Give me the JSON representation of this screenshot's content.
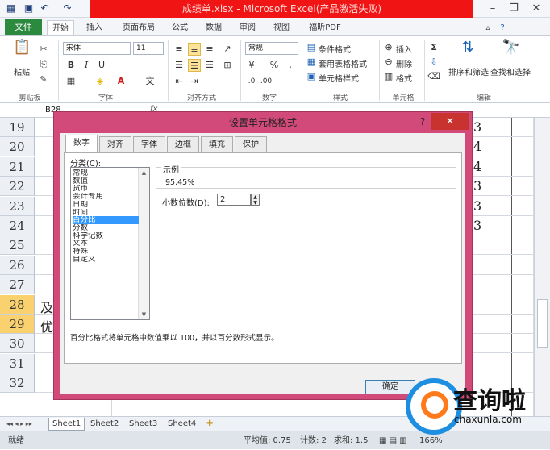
{
  "titlebar": {
    "title": "成绩单.xlsx - Microsoft Excel(产品激活失败)",
    "minimize": "–",
    "restore": "❐",
    "close": "✕"
  },
  "menu": {
    "file": "文件",
    "tabs": [
      "开始",
      "插入",
      "页面布局",
      "公式",
      "数据",
      "审阅",
      "视图",
      "福昕PDF"
    ]
  },
  "ribbon": {
    "clipboard": {
      "paste": "粘贴",
      "group": "剪贴板"
    },
    "font": {
      "name": "宋体",
      "size": "11",
      "group": "字体",
      "bold": "B",
      "italic": "I",
      "underline": "U",
      "font_color_glyph": "A"
    },
    "alignment": {
      "group": "对齐方式"
    },
    "number": {
      "format": "常规",
      "percent": "%",
      "comma": ",",
      "group": "数字"
    },
    "styles": {
      "cond": "条件格式",
      "table": "套用表格格式",
      "cell": "单元格样式",
      "group": "样式"
    },
    "cells": {
      "insert": "插入",
      "delete": "删除",
      "format": "格式",
      "group": "单元格"
    },
    "editing": {
      "sort": "排序和筛选",
      "find": "查找和选择",
      "sigma": "Σ",
      "group": "编辑"
    }
  },
  "formula_bar": {
    "name_box": "B28",
    "fx": "fx"
  },
  "grid": {
    "rows": [
      {
        "num": "19",
        "a": "",
        "right": "3"
      },
      {
        "num": "20",
        "a": "",
        "right": "4"
      },
      {
        "num": "21",
        "a": "",
        "right": "4"
      },
      {
        "num": "22",
        "a": "",
        "right": "3"
      },
      {
        "num": "23",
        "a": "",
        "right": "3"
      },
      {
        "num": "24",
        "a": "",
        "right": "3"
      },
      {
        "num": "25",
        "a": "",
        "right": ""
      },
      {
        "num": "26",
        "a": "",
        "right": ""
      },
      {
        "num": "27",
        "a": "",
        "right": ""
      },
      {
        "num": "28",
        "a": "及",
        "right": ""
      },
      {
        "num": "29",
        "a": "优",
        "right": ""
      },
      {
        "num": "30",
        "a": "",
        "right": ""
      },
      {
        "num": "31",
        "a": "",
        "right": ""
      },
      {
        "num": "32",
        "a": "",
        "right": ""
      }
    ]
  },
  "sheets": [
    "Sheet1",
    "Sheet2",
    "Sheet3",
    "Sheet4"
  ],
  "status": {
    "ready": "就绪",
    "avg": "平均值: 0.75",
    "count": "计数: 2",
    "sum": "求和: 1.5",
    "zoom": "166%"
  },
  "dialog": {
    "title": "设置单元格格式",
    "help": "?",
    "close": "✕",
    "tabs": [
      "数字",
      "对齐",
      "字体",
      "边框",
      "填充",
      "保护"
    ],
    "category_label": "分类(C):",
    "categories": [
      "常规",
      "数值",
      "货币",
      "会计专用",
      "日期",
      "时间",
      "百分比",
      "分数",
      "科学记数",
      "文本",
      "特殊",
      "自定义"
    ],
    "selected_category": "百分比",
    "sample_label": "示例",
    "sample_value": "95.45%",
    "decimal_label": "小数位数(D):",
    "decimal_value": "2",
    "description": "百分比格式将单元格中数值乘以 100，并以百分数形式显示。",
    "ok": "确定"
  },
  "watermark": {
    "brand": "查询啦",
    "site": "chaxunla.com"
  }
}
